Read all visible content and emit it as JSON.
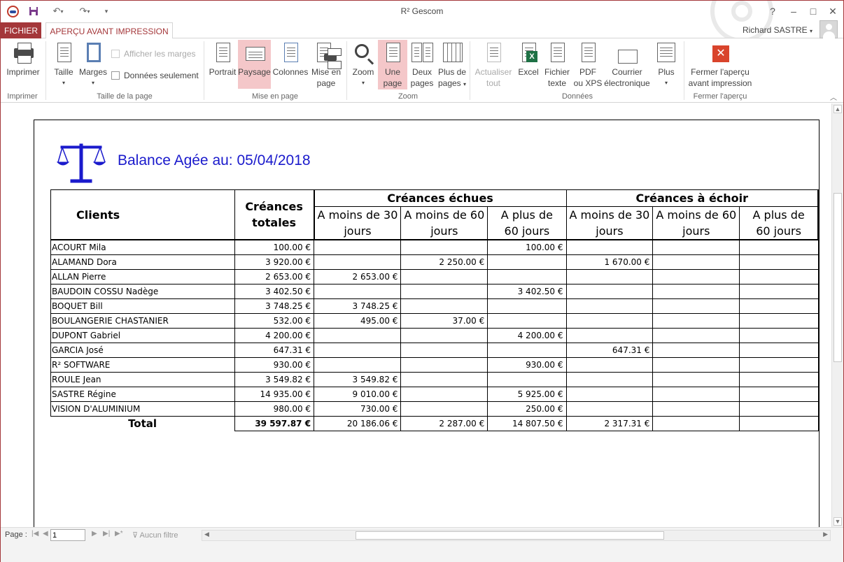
{
  "window": {
    "title": "R² Gescom",
    "help": "?",
    "minimize": "–",
    "restore": "□",
    "close": "✕"
  },
  "tabs": {
    "file": "FICHIER",
    "active": "APERÇU AVANT IMPRESSION"
  },
  "user": {
    "name": "Richard SASTRE"
  },
  "ribbon": {
    "imprimer": {
      "button": "Imprimer",
      "group": "Imprimer"
    },
    "taille_page": {
      "taille": "Taille",
      "marges": "Marges",
      "afficher_marges": "Afficher les marges",
      "donnees_seulement": "Données seulement",
      "group": "Taille de la page"
    },
    "mise_en_page": {
      "portrait": "Portrait",
      "paysage": "Paysage",
      "colonnes": "Colonnes",
      "mise_en_page_l1": "Mise en",
      "mise_en_page_l2": "page",
      "group": "Mise en page"
    },
    "zoom": {
      "zoom": "Zoom",
      "une_l1": "Une",
      "une_l2": "page",
      "deux_l1": "Deux",
      "deux_l2": "pages",
      "plus_l1": "Plus de",
      "plus_l2": "pages",
      "group": "Zoom"
    },
    "donnees": {
      "actualiser_l1": "Actualiser",
      "actualiser_l2": "tout",
      "excel": "Excel",
      "fichier_l1": "Fichier",
      "fichier_l2": "texte",
      "pdf_l1": "PDF",
      "pdf_l2": "ou XPS",
      "courrier_l1": "Courrier",
      "courrier_l2": "électronique",
      "plus": "Plus",
      "group": "Données"
    },
    "fermer": {
      "l1": "Fermer l'aperçu",
      "l2": "avant impression",
      "group": "Fermer l'aperçu"
    }
  },
  "report": {
    "title": "Balance Agée au: 05/04/2018",
    "headers": {
      "clients": "Clients",
      "creances_l1": "Créances",
      "creances_l2": "totales",
      "echues": "Créances échues",
      "a_echoir": "Créances à échoir",
      "m30_l1": "A moins de 30",
      "m30_l2": "jours",
      "m60_l1": "A moins de 60",
      "m60_l2": "jours",
      "p60_l1": "A plus de",
      "p60_l2": "60 jours"
    },
    "rows": [
      {
        "client": "ACOURT Mila",
        "total": "100.00 €",
        "e30": "",
        "e60": "",
        "ep60": "100.00 €",
        "a30": "",
        "a60": "",
        "ap60": ""
      },
      {
        "client": "ALAMAND Dora",
        "total": "3 920.00 €",
        "e30": "",
        "e60": "2 250.00 €",
        "ep60": "",
        "a30": "1 670.00 €",
        "a60": "",
        "ap60": ""
      },
      {
        "client": "ALLAN Pierre",
        "total": "2 653.00 €",
        "e30": "2 653.00 €",
        "e60": "",
        "ep60": "",
        "a30": "",
        "a60": "",
        "ap60": ""
      },
      {
        "client": "BAUDOIN COSSU Nadège",
        "total": "3 402.50 €",
        "e30": "",
        "e60": "",
        "ep60": "3 402.50 €",
        "a30": "",
        "a60": "",
        "ap60": ""
      },
      {
        "client": "BOQUET Bill",
        "total": "3 748.25 €",
        "e30": "3 748.25 €",
        "e60": "",
        "ep60": "",
        "a30": "",
        "a60": "",
        "ap60": ""
      },
      {
        "client": "BOULANGERIE CHASTANIER",
        "total": "532.00 €",
        "e30": "495.00 €",
        "e60": "37.00 €",
        "ep60": "",
        "a30": "",
        "a60": "",
        "ap60": ""
      },
      {
        "client": "DUPONT Gabriel",
        "total": "4 200.00 €",
        "e30": "",
        "e60": "",
        "ep60": "4 200.00 €",
        "a30": "",
        "a60": "",
        "ap60": ""
      },
      {
        "client": "GARCIA José",
        "total": "647.31 €",
        "e30": "",
        "e60": "",
        "ep60": "",
        "a30": "647.31 €",
        "a60": "",
        "ap60": ""
      },
      {
        "client": "R² SOFTWARE",
        "total": "930.00 €",
        "e30": "",
        "e60": "",
        "ep60": "930.00 €",
        "a30": "",
        "a60": "",
        "ap60": ""
      },
      {
        "client": "ROULE Jean",
        "total": "3 549.82 €",
        "e30": "3 549.82 €",
        "e60": "",
        "ep60": "",
        "a30": "",
        "a60": "",
        "ap60": ""
      },
      {
        "client": "SASTRE Régine",
        "total": "14 935.00 €",
        "e30": "9 010.00 €",
        "e60": "",
        "ep60": "5 925.00 €",
        "a30": "",
        "a60": "",
        "ap60": ""
      },
      {
        "client": "VISION D'ALUMINIUM",
        "total": "980.00 €",
        "e30": "730.00 €",
        "e60": "",
        "ep60": "250.00 €",
        "a30": "",
        "a60": "",
        "ap60": ""
      }
    ],
    "total": {
      "label": "Total",
      "total": "39 597.87 €",
      "e30": "20 186.06 €",
      "e60": "2 287.00 €",
      "ep60": "14 807.50 €",
      "a30": "2 317.31 €",
      "a60": "",
      "ap60": ""
    }
  },
  "statusbar": {
    "page_label": "Page :",
    "page_value": "1",
    "filter": "Aucun filtre"
  },
  "colors": {
    "accent": "#a4373a",
    "title_blue": "#1a1acc",
    "selected": "#f4c7c9"
  }
}
